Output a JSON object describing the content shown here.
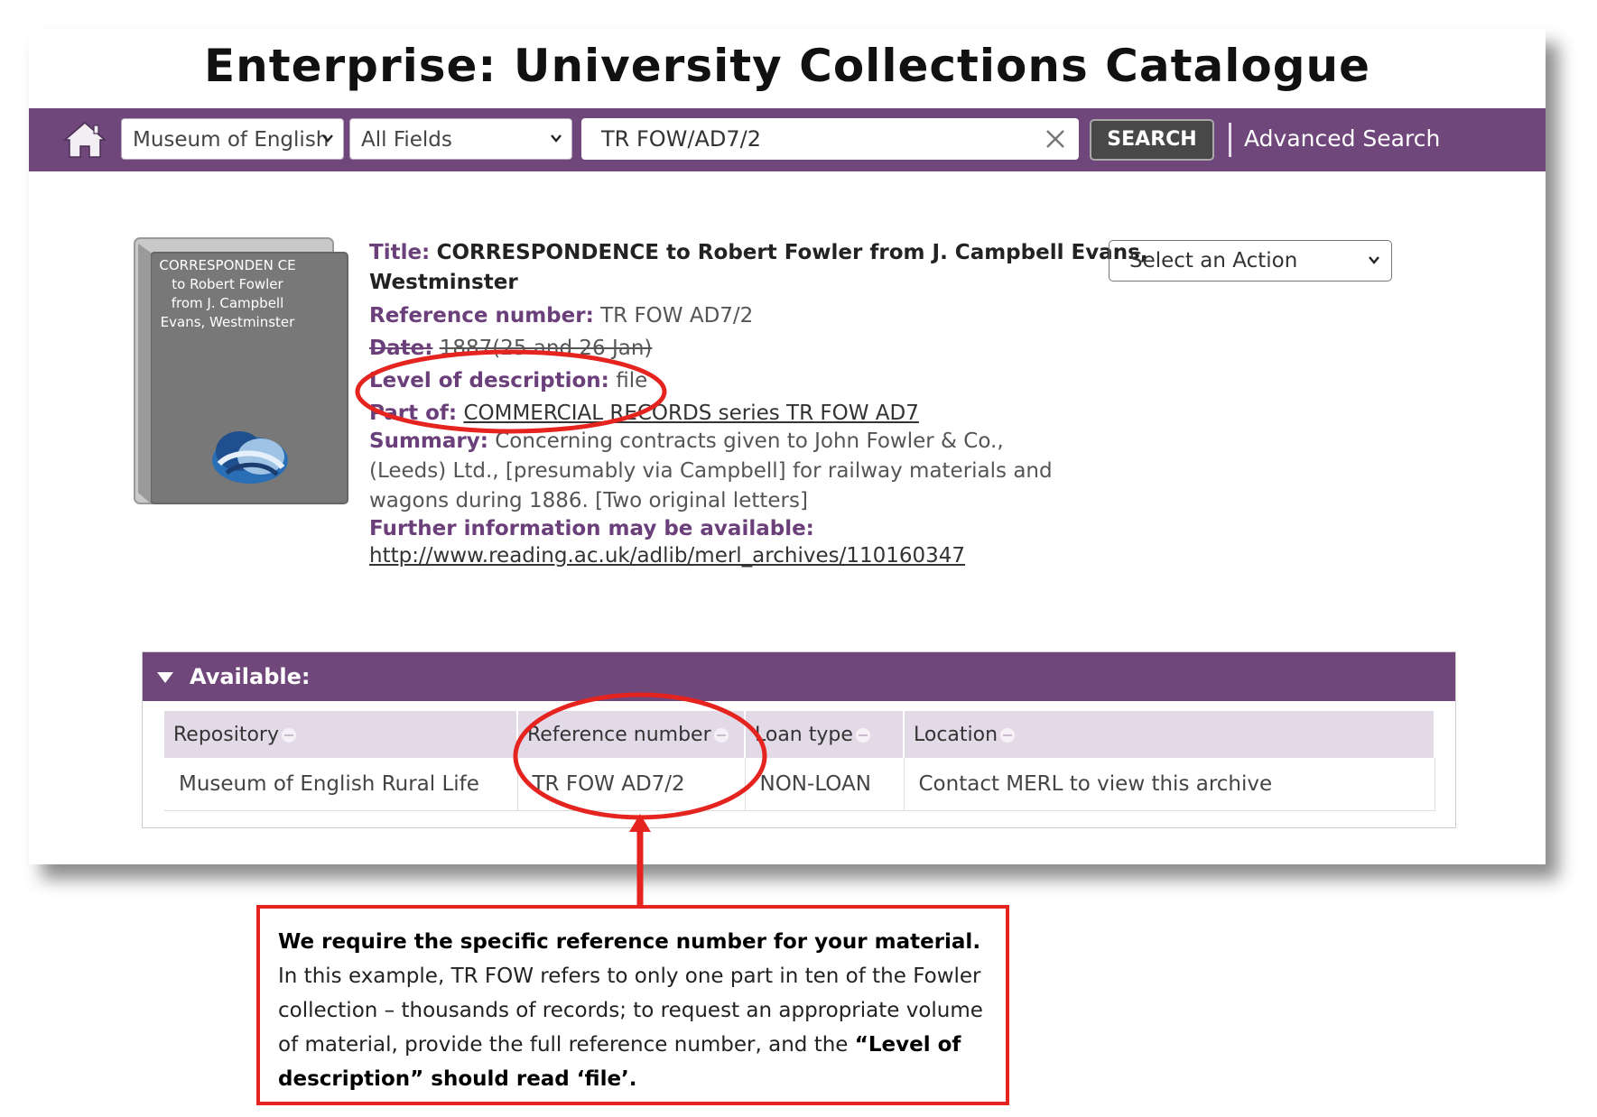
{
  "page": {
    "title": "Enterprise: University Collections Catalogue"
  },
  "navbar": {
    "collection_select": "Museum of English",
    "field_select": "All Fields",
    "search_value": "TR FOW/AD7/2",
    "search_button": "SEARCH",
    "advanced_search": "Advanced Search"
  },
  "thumbnail": {
    "title": "CORRESPONDEN CE to Robert Fowler from J. Campbell Evans, Westminster"
  },
  "record": {
    "title_label": "Title:",
    "title_line1": "CORRESPONDENCE to Robert Fowler from J. Campbell Evans,",
    "title_line2": "Westminster",
    "ref_label": "Reference number:",
    "ref_value": "TR FOW AD7/2",
    "date_label": "Date:",
    "date_value": "1887(25 and 26 Jan)",
    "level_label": "Level of description:",
    "level_value": "file",
    "partof_label": "Part of:",
    "partof_value": "COMMERCIAL RECORDS series TR FOW AD7",
    "summary_label": "Summary:",
    "summary_value": "Concerning contracts given to John Fowler & Co., (Leeds) Ltd., [presumably via Campbell] for railway materials and wagons during 1886. [Two original letters]",
    "further_label": "Further information may be available:",
    "further_link": "http://www.reading.ac.uk/adlib/merl_archives/110160347"
  },
  "action_select": {
    "label": "Select an Action"
  },
  "availability": {
    "header": "Available:",
    "columns": [
      "Repository",
      "Reference number",
      "Loan type",
      "Location"
    ],
    "rows": [
      [
        "Museum of English Rural Life",
        "TR FOW AD7/2",
        "NON-LOAN",
        "Contact MERL to view this archive"
      ]
    ]
  },
  "callout": {
    "bold_intro": "We require the specific reference number for your material.",
    "body": " In this example, TR FOW refers to only one part in ten of the Fowler collection  – thousands of records; to request an appropriate volume of material, provide the full reference number, and the ",
    "bold_end": "“Level of description” should read ‘file’."
  },
  "colors": {
    "brand_purple": "#6f477b",
    "annotation_red": "#e52420",
    "table_header_bg": "#e2dbe7"
  }
}
